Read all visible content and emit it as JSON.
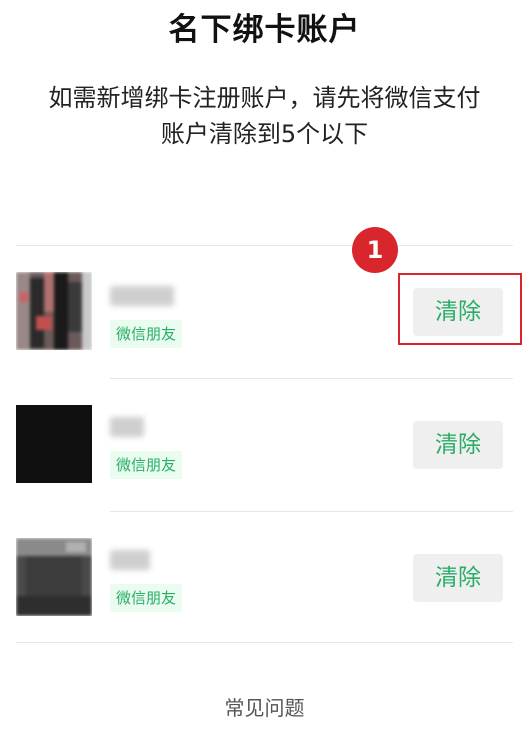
{
  "header": {
    "title": "名下绑卡账户",
    "description_line1": "如需新增绑卡注册账户，请先将微信支付",
    "description_line2": "账户清除到5个以下"
  },
  "accounts": [
    {
      "tag": "微信朋友",
      "clear_label": "清除"
    },
    {
      "tag": "微信朋友",
      "clear_label": "清除"
    },
    {
      "tag": "微信朋友",
      "clear_label": "清除"
    }
  ],
  "annotation": {
    "step_number": "1",
    "color": "#d9262c"
  },
  "footer": {
    "faq_label": "常见问题"
  },
  "colors": {
    "accent_green": "#2aae67",
    "button_bg": "#efefef"
  }
}
